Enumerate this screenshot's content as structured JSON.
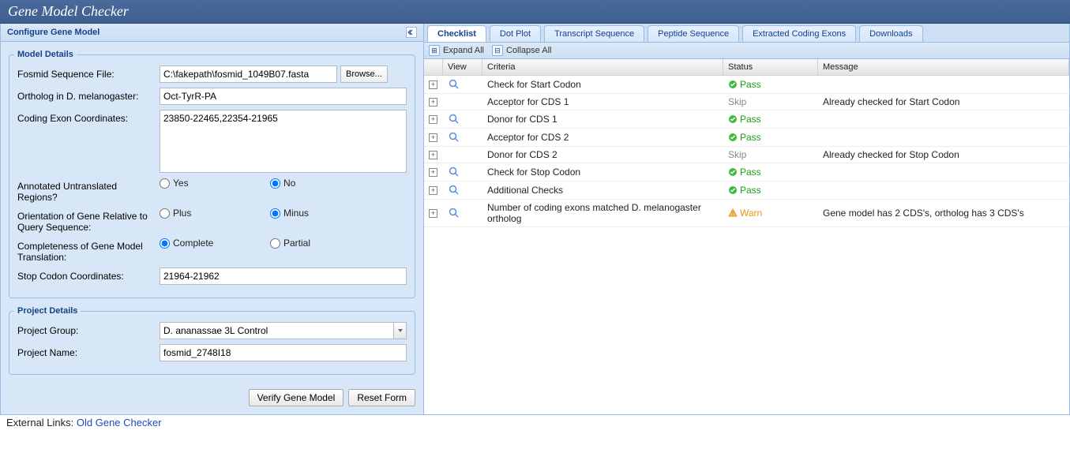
{
  "header": {
    "title": "Gene Model Checker"
  },
  "left": {
    "panel_title": "Configure Gene Model",
    "model_details": {
      "legend": "Model Details",
      "fosmid_label": "Fosmid Sequence File:",
      "fosmid_value": "C:\\fakepath\\fosmid_1049B07.fasta",
      "browse_label": "Browse...",
      "ortholog_label": "Ortholog in D. melanogaster:",
      "ortholog_value": "Oct-TyrR-PA",
      "coords_label": "Coding Exon Coordinates:",
      "coords_value": "23850-22465,22354-21965",
      "utr_label": "Annotated Untranslated Regions?",
      "utr_yes": "Yes",
      "utr_no": "No",
      "utr_value": "No",
      "orient_label": "Orientation of Gene Relative to Query Sequence:",
      "orient_plus": "Plus",
      "orient_minus": "Minus",
      "orient_value": "Minus",
      "complete_label": "Completeness of Gene Model Translation:",
      "complete_complete": "Complete",
      "complete_partial": "Partial",
      "complete_value": "Complete",
      "stop_label": "Stop Codon Coordinates:",
      "stop_value": "21964-21962"
    },
    "project_details": {
      "legend": "Project Details",
      "group_label": "Project Group:",
      "group_value": "D. ananassae 3L Control",
      "name_label": "Project Name:",
      "name_value": "fosmid_2748I18"
    },
    "buttons": {
      "verify": "Verify Gene Model",
      "reset": "Reset Form"
    }
  },
  "right": {
    "tabs": [
      "Checklist",
      "Dot Plot",
      "Transcript Sequence",
      "Peptide Sequence",
      "Extracted Coding Exons",
      "Downloads"
    ],
    "active_tab": 0,
    "toolbar": {
      "expand": "Expand All",
      "collapse": "Collapse All"
    },
    "columns": {
      "view": "View",
      "criteria": "Criteria",
      "status": "Status",
      "message": "Message"
    },
    "rows": [
      {
        "view": true,
        "criteria": "Check for Start Codon",
        "status": "Pass",
        "message": ""
      },
      {
        "view": false,
        "criteria": "Acceptor for CDS 1",
        "status": "Skip",
        "message": "Already checked for Start Codon"
      },
      {
        "view": true,
        "criteria": "Donor for CDS 1",
        "status": "Pass",
        "message": ""
      },
      {
        "view": true,
        "criteria": "Acceptor for CDS 2",
        "status": "Pass",
        "message": ""
      },
      {
        "view": false,
        "criteria": "Donor for CDS 2",
        "status": "Skip",
        "message": "Already checked for Stop Codon"
      },
      {
        "view": true,
        "criteria": "Check for Stop Codon",
        "status": "Pass",
        "message": ""
      },
      {
        "view": true,
        "criteria": "Additional Checks",
        "status": "Pass",
        "message": ""
      },
      {
        "view": true,
        "criteria": "Number of coding exons matched D. melanogaster ortholog",
        "status": "Warn",
        "message": "Gene model has 2 CDS's, ortholog has 3 CDS's"
      }
    ]
  },
  "external": {
    "label": "External Links:",
    "link": "Old Gene Checker"
  }
}
